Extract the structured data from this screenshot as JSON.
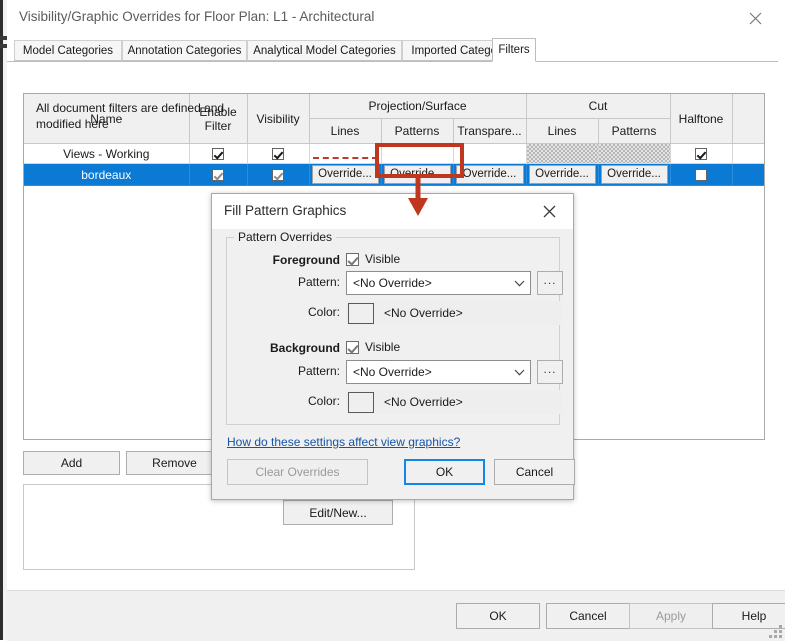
{
  "window": {
    "title": "Visibility/Graphic Overrides for Floor Plan: L1 - Architectural",
    "close_icon": "close-icon"
  },
  "tabs": [
    {
      "label": "Model Categories",
      "active": false
    },
    {
      "label": "Annotation Categories",
      "active": false
    },
    {
      "label": "Analytical Model Categories",
      "active": false
    },
    {
      "label": "Imported Categories",
      "active": false
    },
    {
      "label": "Filters",
      "active": true
    }
  ],
  "filters_table": {
    "headers": {
      "name": "Name",
      "enable_filter": "Enable\nFilter",
      "enable_filter_line1": "Enable",
      "enable_filter_line2": "Filter",
      "visibility": "Visibility",
      "projection_surface": "Projection/Surface",
      "cut": "Cut",
      "halftone": "Halftone",
      "lines": "Lines",
      "patterns": "Patterns",
      "transparency": "Transpare...",
      "cut_lines": "Lines",
      "cut_patterns": "Patterns"
    },
    "override_label": "Override...",
    "rows": [
      {
        "name": "Views - Working",
        "selected": false,
        "enable_filter": true,
        "visibility": true,
        "proj_lines": "dashed-red-line",
        "proj_patterns": "",
        "proj_transparency": "",
        "cut_lines": "hatched",
        "cut_patterns": "hatched",
        "halftone": true
      },
      {
        "name": "bordeaux",
        "selected": true,
        "enable_filter": true,
        "visibility": true,
        "proj_lines": "Override...",
        "proj_patterns": "Override...",
        "proj_transparency": "Override...",
        "cut_lines": "Override...",
        "cut_patterns": "Override...",
        "halftone": false
      }
    ]
  },
  "filter_buttons": {
    "add": "Add",
    "remove": "Remove"
  },
  "info_panel": {
    "text": "All document filters are defined and modified here",
    "edit_new": "Edit/New..."
  },
  "bottom_buttons": {
    "ok": "OK",
    "cancel": "Cancel",
    "apply": "Apply",
    "apply_disabled": true,
    "help": "Help"
  },
  "fill_pattern_dialog": {
    "title": "Fill Pattern Graphics",
    "close_icon": "close-icon",
    "group_label": "Pattern Overrides",
    "foreground": {
      "label": "Foreground",
      "visible_label": "Visible",
      "visible_checked": true,
      "pattern_label": "Pattern:",
      "pattern_value": "<No Override>",
      "pattern_browse": "...",
      "color_label": "Color:",
      "color_value": "<No Override>",
      "color_swatch": "#efefef"
    },
    "background": {
      "label": "Background",
      "visible_label": "Visible",
      "visible_checked": true,
      "pattern_label": "Pattern:",
      "pattern_value": "<No Override>",
      "pattern_browse": "...",
      "color_label": "Color:",
      "color_value": "<No Override>",
      "color_swatch": "#efefef"
    },
    "help_link": "How do these settings affect view graphics?",
    "clear_overrides": "Clear Overrides",
    "clear_overrides_disabled": true,
    "ok": "OK",
    "cancel": "Cancel"
  },
  "annotation": {
    "highlight_target": "projection-surface-patterns-override-button",
    "color": "#c0371f"
  },
  "colors": {
    "selection_blue": "#0b7ad4",
    "accent_focus": "#1186e8",
    "link_blue": "#1455a8",
    "annotation_red": "#c0371f",
    "dashed_line_red": "#c0392b"
  }
}
